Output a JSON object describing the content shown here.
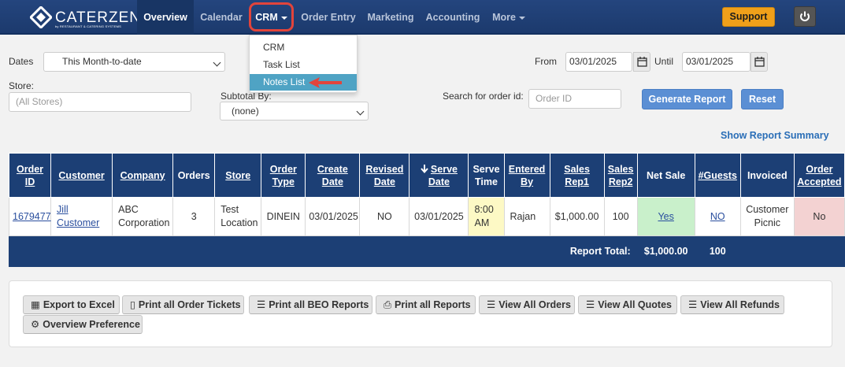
{
  "app": {
    "logo_text": "CATERZEN",
    "logo_sub": "by RESTAURANT & CATERING SYSTEMS",
    "logo_icon": "diamond-logo-icon"
  },
  "nav": {
    "items": [
      {
        "label": "Overview"
      },
      {
        "label": "Calendar"
      },
      {
        "label": "CRM"
      },
      {
        "label": "Order Entry"
      },
      {
        "label": "Marketing"
      },
      {
        "label": "Accounting"
      },
      {
        "label": "More"
      }
    ],
    "support_label": "Support",
    "power_icon": "power-icon"
  },
  "crm_menu": {
    "items": [
      {
        "label": "CRM"
      },
      {
        "label": "Task List"
      },
      {
        "label": "Notes List"
      }
    ],
    "highlight_color": "#e2443b",
    "active_color": "#4fa3c4"
  },
  "filters": {
    "dates_label": "Dates",
    "dates_value": "This Month-to-date",
    "store_label": "Store:",
    "store_placeholder": "(All Stores)",
    "subtotal_label": "Subtotal By:",
    "subtotal_value": "(none)",
    "from_label": "From",
    "from_value": "03/01/2025",
    "until_label": "Until",
    "until_value": "03/01/2025",
    "search_label": "Search for order id:",
    "search_placeholder": "Order ID",
    "generate_label": "Generate Report",
    "reset_label": "Reset",
    "summary_link": "Show Report Summary"
  },
  "table": {
    "headers": [
      {
        "line1": "Order",
        "line2": "ID"
      },
      {
        "line1": "Customer",
        "line2": ""
      },
      {
        "line1": "Company",
        "line2": ""
      },
      {
        "line1": "Orders",
        "line2": ""
      },
      {
        "line1": "Store",
        "line2": ""
      },
      {
        "line1": "Order",
        "line2": "Type"
      },
      {
        "line1": "Create",
        "line2": "Date"
      },
      {
        "line1": "Revised",
        "line2": "Date"
      },
      {
        "line1": "Serve",
        "line2": "Date"
      },
      {
        "line1": "Serve",
        "line2": "Time"
      },
      {
        "line1": "Entered",
        "line2": "By"
      },
      {
        "line1": "Sales",
        "line2": "Rep1"
      },
      {
        "line1": "Sales",
        "line2": "Rep2"
      },
      {
        "line1": "Net Sale",
        "line2": ""
      },
      {
        "line1": "#Guests",
        "line2": ""
      },
      {
        "line1": "Invoiced",
        "line2": ""
      },
      {
        "line1": "Order",
        "line2": "Accepted"
      }
    ],
    "row": {
      "order_id": "1679477",
      "customer_1": "Jill",
      "customer_2": "Customer",
      "company_1": "ABC",
      "company_2": "Corporation",
      "orders": "3",
      "store_1": "Test",
      "store_2": "Location",
      "order_type": "DINEIN",
      "create_date": "03/01/2025",
      "revised_date": "NO",
      "serve_date": "03/01/2025",
      "serve_time_1": "8:00",
      "serve_time_2": "AM",
      "entered_by": "Rajan",
      "sales_rep1": "$1,000.00",
      "sales_rep2": "100",
      "net_sale": "Yes",
      "guests": "NO",
      "invoiced_1": "Customer",
      "invoiced_2": "Picnic",
      "order_accepted": "No"
    },
    "total": {
      "label": "Report Total:",
      "amount": "$1,000.00",
      "guests": "100"
    },
    "sort_icon": "arrow-down-icon"
  },
  "actions": [
    {
      "label": "Export to Excel",
      "icon": "grid-icon"
    },
    {
      "label": "Print all Order Tickets",
      "icon": "ticket-icon"
    },
    {
      "label": "Print all BEO Reports",
      "icon": "list-icon"
    },
    {
      "label": "Print all Reports",
      "icon": "printer-icon"
    },
    {
      "label": "View All Orders",
      "icon": "lines-icon"
    },
    {
      "label": "View All Quotes",
      "icon": "list-icon"
    },
    {
      "label": "View All Refunds",
      "icon": "lines-icon"
    },
    {
      "label": "Overview Preference",
      "icon": "gear-icon"
    }
  ]
}
